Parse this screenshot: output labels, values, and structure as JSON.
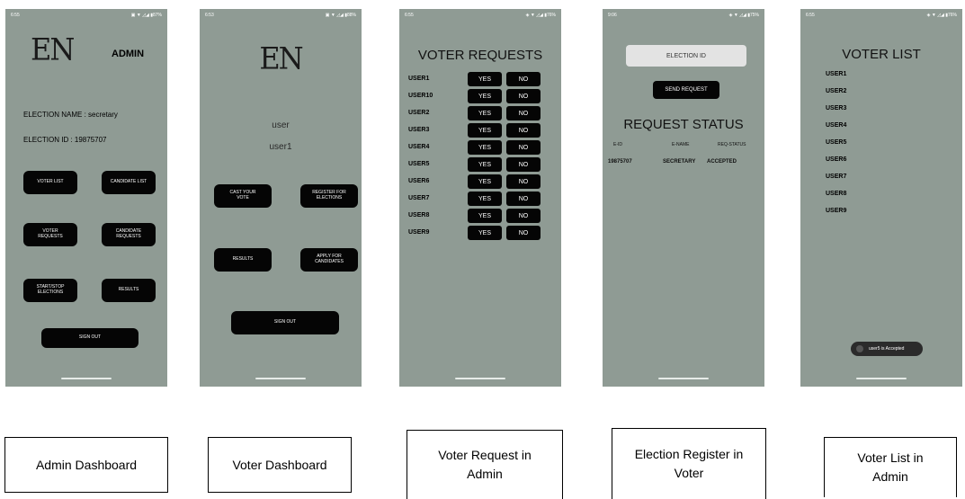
{
  "phones": {
    "admin_dashboard": {
      "time": "6:55",
      "status_icons": "▣ ▼ ◿◢ ▮87%",
      "logo": "EN",
      "header": "ADMIN",
      "election_name": "ELECTION NAME : secretary",
      "election_id": "ELECTION ID : 19875707",
      "buttons": {
        "voter_list": "VOTER LIST",
        "candidate_list": "CANDIDATE LIST",
        "voter_requests": "VOTER REQUESTS",
        "candidate_requests": "CANDIDATE REQUESTS",
        "start_stop": "START/STOP ELECTIONS",
        "results": "RESULTS",
        "sign_out": "SIGN OUT"
      }
    },
    "voter_dashboard": {
      "time": "6:53",
      "status_icons": "▣ ▼ ◿◢ ▮88%",
      "logo": "EN",
      "role": "user",
      "username": "user1",
      "buttons": {
        "cast_vote": "CAST YOUR VOTE",
        "register": "REGISTER FOR ELECTIONS",
        "results": "RESULTS",
        "apply": "APPLY FOR CANDIDATES",
        "sign_out": "SIGN OUT"
      }
    },
    "voter_requests": {
      "time": "6:55",
      "status_icons": "◈ ▼ ◿◢ ▮76%",
      "title": "VOTER REQUESTS",
      "yes_label": "YES",
      "no_label": "NO",
      "users": [
        "USER1",
        "USER10",
        "USER2",
        "USER3",
        "USER4",
        "USER5",
        "USER6",
        "USER7",
        "USER8",
        "USER9"
      ]
    },
    "election_register": {
      "time": "9:06",
      "status_icons": "◈ ▼ ◿◢ ▮75%",
      "election_id_placeholder": "ELECTION ID",
      "send_request": "SEND REQUEST",
      "title": "REQUEST STATUS",
      "columns": [
        "E-ID",
        "E-NAME",
        "REQ-STATUS"
      ],
      "row": [
        "19875707",
        "SECRETARY",
        "ACCEPTED"
      ]
    },
    "voter_list": {
      "time": "6:55",
      "status_icons": "◈ ▼ ◿◢ ▮76%",
      "title": "VOTER LIST",
      "users": [
        "USER1",
        "USER2",
        "USER3",
        "USER4",
        "USER5",
        "USER6",
        "USER7",
        "USER8",
        "USER9"
      ],
      "toast": "user5 is Accepted"
    }
  },
  "captions": {
    "admin_dashboard": "Admin Dashboard",
    "voter_dashboard": "Voter Dashboard",
    "voter_request": "Voter Request in Admin",
    "election_register": "Election Register in Voter",
    "voter_list": "Voter List in Admin"
  },
  "colors": {
    "screen_bg": "#8f9b94",
    "button_bg": "#050505",
    "page_bg": "#ffffff"
  }
}
